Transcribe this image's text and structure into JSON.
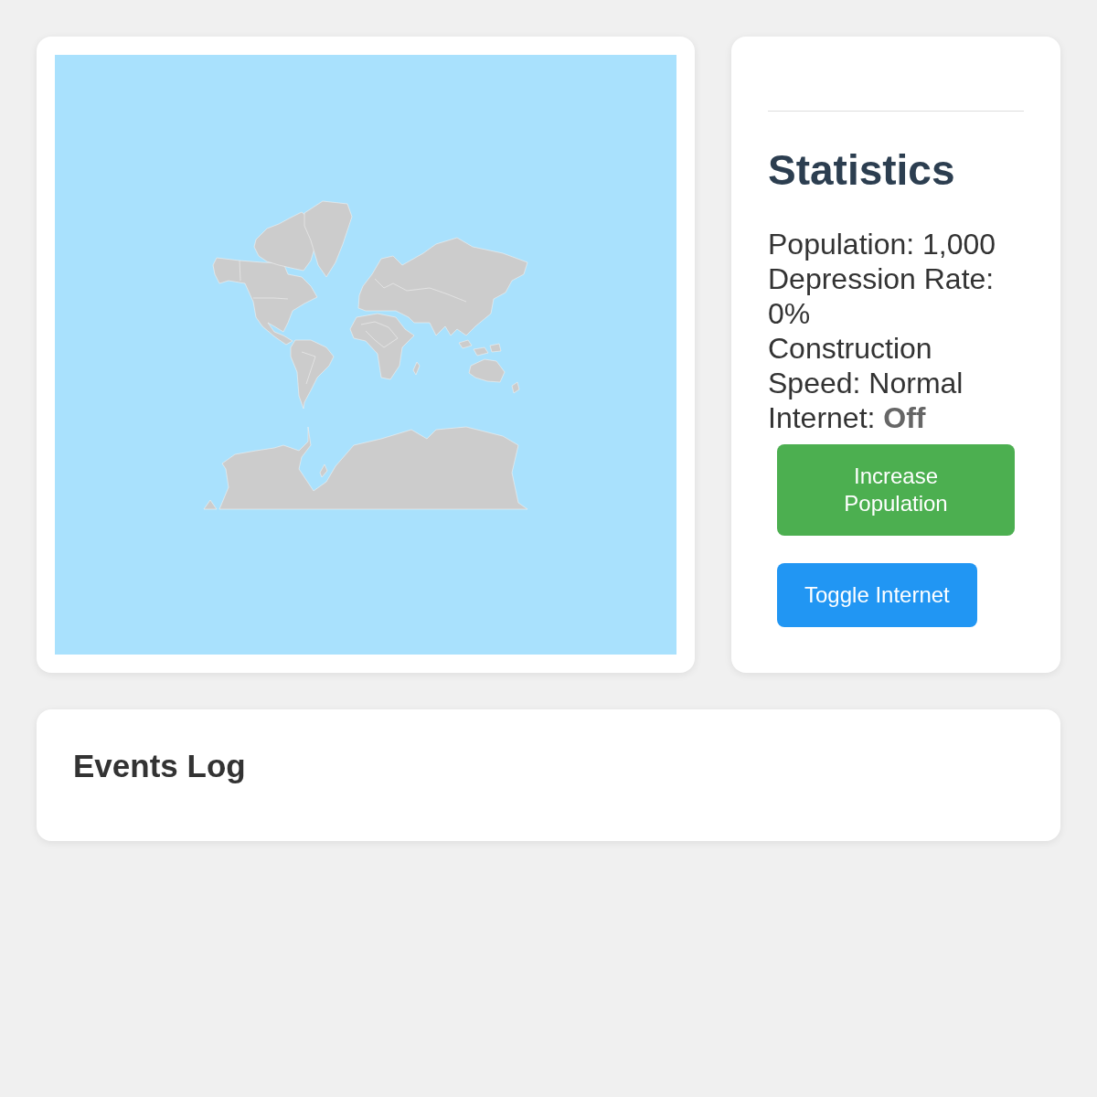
{
  "statistics": {
    "title": "Statistics",
    "stats": [
      {
        "kind": "plain",
        "label": "Population:",
        "value": "1,000"
      },
      {
        "kind": "plain",
        "label": "Depression Rate:",
        "value": "0%"
      },
      {
        "kind": "plain",
        "label": "Construction Speed:",
        "value": "Normal"
      },
      {
        "kind": "status",
        "label": "Internet:",
        "value": "Off"
      }
    ],
    "buttons": [
      {
        "label": "Increase Population",
        "color": "#4caf50"
      },
      {
        "label": "Toggle Internet",
        "color": "#2196f3"
      }
    ]
  },
  "events_log": {
    "title": "Events Log"
  }
}
